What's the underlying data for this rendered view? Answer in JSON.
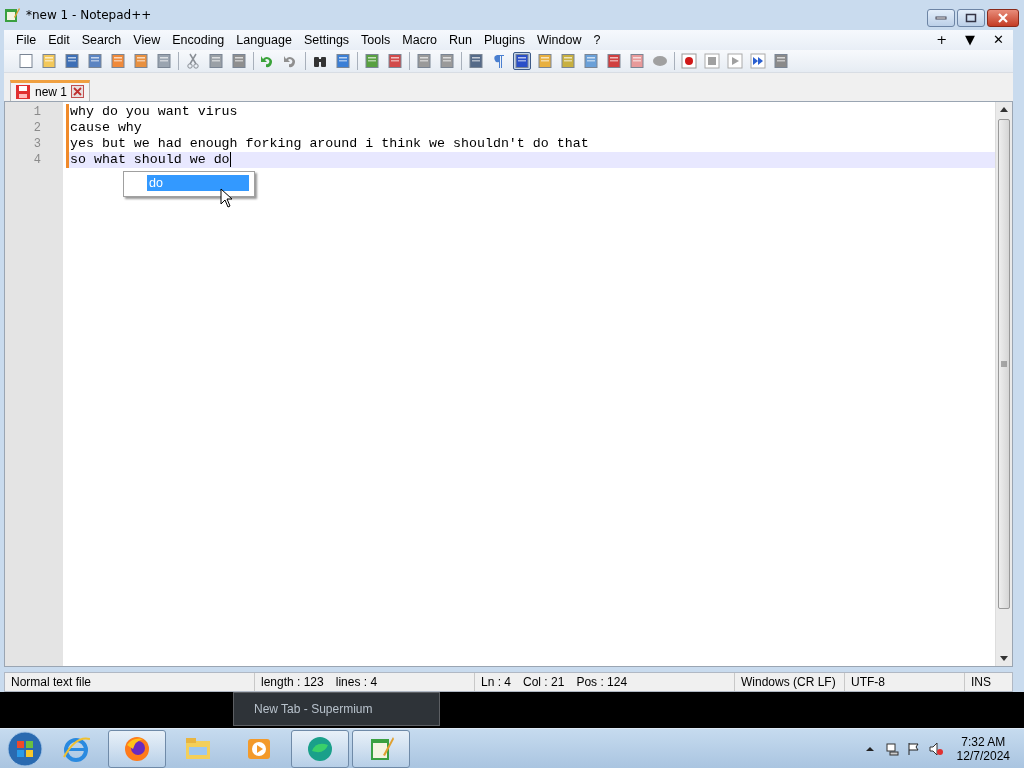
{
  "window": {
    "title": "*new 1 - Notepad++"
  },
  "menu": [
    "File",
    "Edit",
    "Search",
    "View",
    "Encoding",
    "Language",
    "Settings",
    "Tools",
    "Macro",
    "Run",
    "Plugins",
    "Window",
    "?"
  ],
  "menu_right": [
    "+",
    "▼",
    "✕"
  ],
  "toolbar_groups": [
    [
      {
        "selected": false
      },
      {
        "selected": false
      },
      {
        "selected": false
      },
      {
        "selected": false
      },
      {
        "selected": false
      },
      {
        "selected": false
      },
      {
        "selected": false
      }
    ],
    [
      {
        "selected": false
      },
      {
        "selected": false
      },
      {
        "selected": false
      }
    ],
    [
      {
        "selected": false
      },
      {
        "selected": false
      }
    ],
    [
      {
        "selected": false
      },
      {
        "selected": false
      }
    ],
    [
      {
        "selected": false
      },
      {
        "selected": false
      }
    ],
    [
      {
        "selected": false
      },
      {
        "selected": false
      }
    ],
    [
      {
        "selected": false
      },
      {
        "selected": false
      },
      {
        "selected": true
      },
      {
        "selected": false
      },
      {
        "selected": false
      },
      {
        "selected": false
      },
      {
        "selected": false
      },
      {
        "selected": false
      },
      {
        "selected": false
      }
    ],
    [
      {
        "selected": false
      },
      {
        "selected": false
      },
      {
        "selected": false
      },
      {
        "selected": false
      },
      {
        "selected": false
      }
    ]
  ],
  "tabs": [
    {
      "label": "new 1",
      "selected": true,
      "modified": true
    }
  ],
  "editor": {
    "lines": [
      {
        "number": "1",
        "text": "why do you want virus",
        "modified": true,
        "current": false
      },
      {
        "number": "2",
        "text": "cause why",
        "modified": true,
        "current": false
      },
      {
        "number": "3",
        "text": "yes but we had enough forking around i think we shouldn't do that",
        "modified": true,
        "current": false
      },
      {
        "number": "4",
        "text": "so what should we do",
        "modified": true,
        "current": true
      }
    ],
    "autocomplete": [
      {
        "label": "do",
        "selected": true
      }
    ]
  },
  "status_bar": [
    [
      "Normal text file"
    ],
    [
      "length : 123",
      "lines : 4"
    ],
    [
      "Ln : 4",
      "Col : 21",
      "Pos : 124"
    ],
    [
      "Windows (CR LF)"
    ],
    [
      "UTF-8"
    ],
    [
      "INS"
    ]
  ],
  "taskbar_preview": {
    "title": "New Tab - Supermium"
  },
  "taskbar": {
    "apps": [
      {
        "selected": false
      },
      {
        "selected": true
      },
      {
        "selected": false
      },
      {
        "selected": false
      },
      {
        "selected": true
      },
      {
        "selected": true
      }
    ],
    "time": "7:32 AM",
    "date": "12/7/2024"
  }
}
